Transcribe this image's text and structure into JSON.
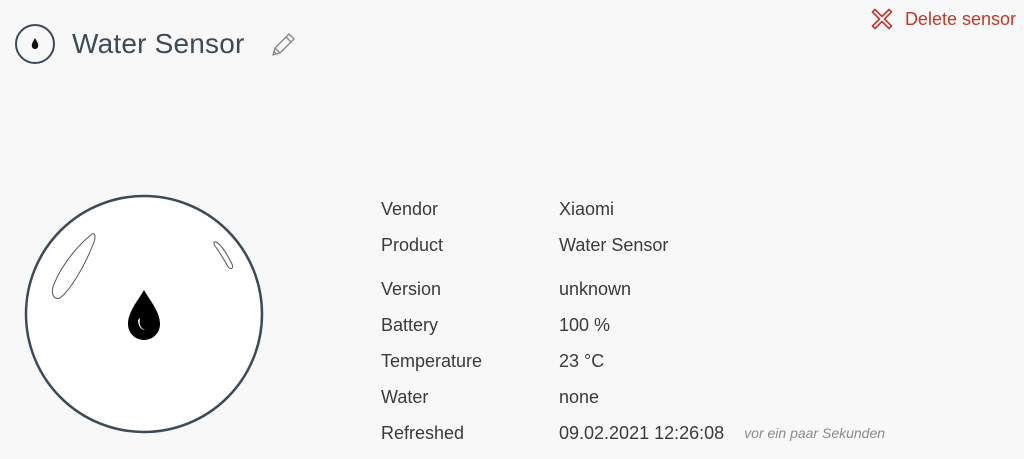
{
  "header": {
    "title": "Water Sensor",
    "sensor_icon": "water-drop-icon",
    "edit_icon": "pencil-icon"
  },
  "actions": {
    "delete_label": "Delete sensor",
    "delete_icon": "close-icon"
  },
  "info": [
    {
      "label": "Vendor",
      "value": "Xiaomi"
    },
    {
      "label": "Product",
      "value": "Water Sensor"
    },
    {
      "label": "Version",
      "value": "unknown"
    },
    {
      "label": "Battery",
      "value": "100 %"
    },
    {
      "label": "Temperature",
      "value": "23 °C"
    },
    {
      "label": "Water",
      "value": "none"
    },
    {
      "label": "Refreshed",
      "value": "09.02.2021 12:26:08",
      "relative": "vor ein paar Sekunden"
    }
  ],
  "colors": {
    "title": "#3d4a57",
    "delete": "#c0392b",
    "background": "#f8f8f8"
  }
}
